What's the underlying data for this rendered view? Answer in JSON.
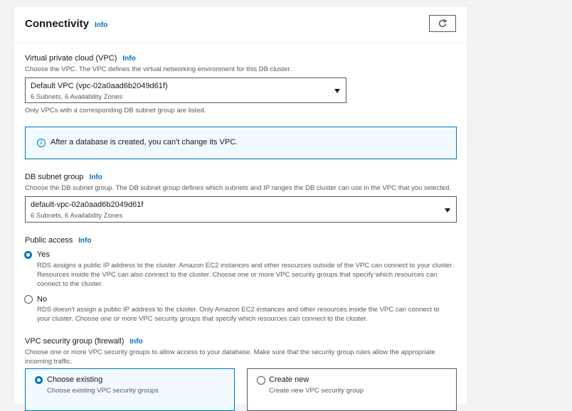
{
  "section": {
    "title": "Connectivity",
    "info": "Info"
  },
  "vpc": {
    "label": "Virtual private cloud (VPC)",
    "info": "Info",
    "description": "Choose the VPC. The VPC defines the virtual networking environment for this DB cluster.",
    "selected": "Default VPC (vpc-02a0aad6b2049d61f)",
    "selected_detail": "6 Subnets, 6 Availability Zones",
    "note": "Only VPCs with a corresponding DB subnet group are listed."
  },
  "alert": {
    "text": "After a database is created, you can't change its VPC."
  },
  "subnet_group": {
    "label": "DB subnet group",
    "info": "Info",
    "description": "Choose the DB subnet group. The DB subnet group defines which subnets and IP ranges the DB cluster can use in the VPC that you selected.",
    "selected": "default-vpc-02a0aad6b2049d61f",
    "selected_detail": "6 Subnets, 6 Availability Zones"
  },
  "public_access": {
    "label": "Public access",
    "info": "Info",
    "options": [
      {
        "label": "Yes",
        "checked": true,
        "desc_lines": [
          "RDS assigns a public IP address to the cluster. Amazon EC2 instances and other resources outside of the VPC can connect to your cluster.",
          "Resources inside the VPC can also connect to the cluster. Choose one or more VPC security groups that specify which resources can",
          "connect to the cluster."
        ]
      },
      {
        "label": "No",
        "checked": false,
        "desc_lines": [
          "RDS doesn't assign a public IP address to the cluster. Only Amazon EC2 instances and other resources inside the VPC can connect to",
          "your cluster. Choose one or more VPC security groups that specify which resources can connect to the cluster."
        ]
      }
    ]
  },
  "security_group": {
    "label": "VPC security group (firewall)",
    "info": "Info",
    "desc_lines": [
      "Choose one or more VPC security groups to allow access to your database. Make sure that the security group rules allow the appropriate",
      "incoming traffic."
    ],
    "options": [
      {
        "label": "Choose existing",
        "detail": "Choose existing VPC security groups",
        "selected": true
      },
      {
        "label": "Create new",
        "detail": "Create new VPC security group",
        "selected": false
      }
    ]
  },
  "colors": {
    "accent": "#0073bb",
    "text": "#16191f",
    "muted": "#545b64",
    "alert_bg": "#f1faff"
  },
  "icons": {
    "refresh": "refresh-icon",
    "info": "info-circle-icon",
    "caret": "caret-down-icon"
  }
}
